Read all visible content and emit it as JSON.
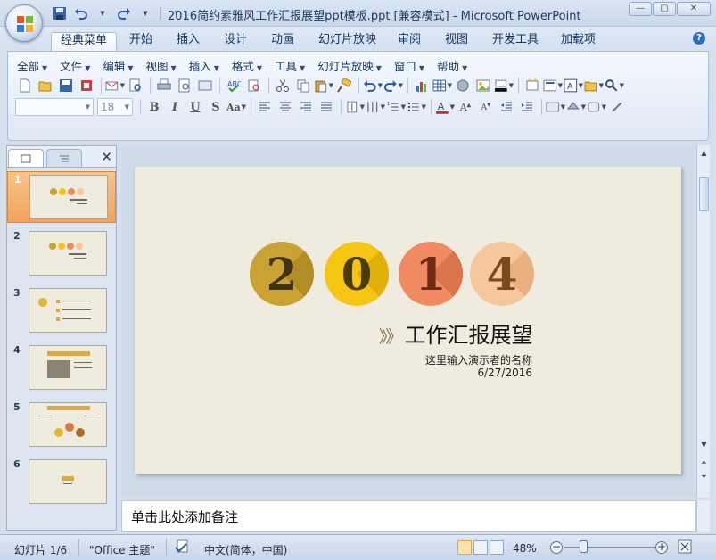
{
  "window": {
    "title": "2016简约素雅风工作汇报展望ppt模板.ppt [兼容模式] - Microsoft PowerPoint",
    "controls": {
      "minimize": "—",
      "maximize": "▢",
      "close": "✕"
    }
  },
  "ribbon_tabs": [
    "经典菜单",
    "开始",
    "插入",
    "设计",
    "动画",
    "幻灯片放映",
    "审阅",
    "视图",
    "开发工具",
    "加载项"
  ],
  "active_tab": "经典菜单",
  "help_label": "?",
  "menu": [
    "全部",
    "文件",
    "编辑",
    "视图",
    "插入",
    "格式",
    "工具",
    "幻灯片放映",
    "窗口",
    "帮助"
  ],
  "format": {
    "font_name": "",
    "font_size": "18"
  },
  "slides": [
    {
      "number": "1",
      "selected": true
    },
    {
      "number": "2",
      "selected": false
    },
    {
      "number": "3",
      "selected": false
    },
    {
      "number": "4",
      "selected": false
    },
    {
      "number": "5",
      "selected": false
    },
    {
      "number": "6",
      "selected": false
    }
  ],
  "slide": {
    "digits": [
      "2",
      "0",
      "1",
      "4"
    ],
    "digit_colors": [
      {
        "bg": "#c9a233",
        "shade": "#b48c25",
        "text": "#3f3515"
      },
      {
        "bg": "#f6c413",
        "shade": "#e2ae08",
        "text": "#4a3b08"
      },
      {
        "bg": "#f08a60",
        "shade": "#db744a",
        "text": "#6e2a10"
      },
      {
        "bg": "#f6c79a",
        "shade": "#e6b07f",
        "text": "#7a4a1f"
      }
    ],
    "title_prefix": "》》",
    "title": "工作汇报展望",
    "presenter": "这里输入演示者的名称",
    "date": "6/27/2016",
    "background": "#efebdf"
  },
  "notes": {
    "placeholder": "单击此处添加备注"
  },
  "status": {
    "slide_counter": "幻灯片 1/6",
    "theme": "\"Office 主题\"",
    "language": "中文(简体，中国)",
    "zoom": "48%",
    "zoom_out": "−",
    "zoom_in": "+"
  }
}
